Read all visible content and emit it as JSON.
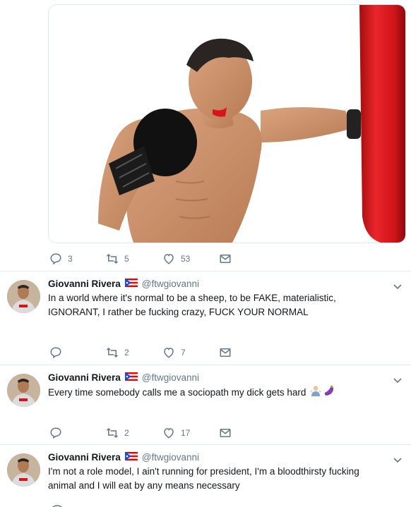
{
  "top_tweet": {
    "reply_count": "3",
    "retweet_count": "5",
    "like_count": "53"
  },
  "tweets": [
    {
      "name": "Giovanni Rivera",
      "handle": "@ftwgiovanni",
      "text": "In a world where it's normal to be a sheep, to be FAKE, materialistic, IGNORANT, I rather be fucking crazy, FUCK YOUR NORMAL",
      "reply_count": "",
      "retweet_count": "2",
      "like_count": "7"
    },
    {
      "name": "Giovanni Rivera",
      "handle": "@ftwgiovanni",
      "text": "Every time somebody calls me a sociopath my dick gets hard",
      "emoji": [
        "person-shrugging-emoji",
        "eggplant-emoji"
      ],
      "reply_count": "",
      "retweet_count": "2",
      "like_count": "17"
    },
    {
      "name": "Giovanni Rivera",
      "handle": "@ftwgiovanni",
      "text": "I'm not a role model, I ain't running for president, I'm a bloodthirsty fucking animal and I will eat by any means necessary"
    }
  ],
  "colors": {
    "text": "#14171a",
    "secondary": "#657786",
    "divider": "#e6ecf0",
    "punching_bag": "#d9161b"
  }
}
